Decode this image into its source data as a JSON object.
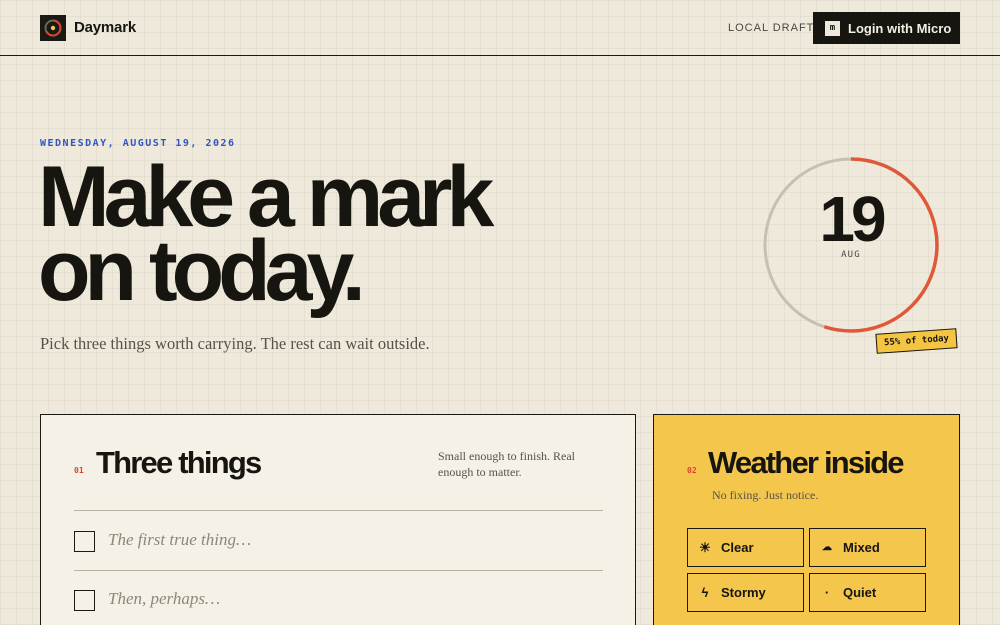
{
  "header": {
    "brand": "Daymark",
    "status": "LOCAL DRAFT",
    "login_label": "Login with Micro",
    "login_icon_glyph": "m"
  },
  "hero": {
    "date": "WEDNESDAY, AUGUST 19, 2026",
    "headline_line1": "Make a mark",
    "headline_line2": "on today.",
    "tagline": "Pick three things worth carrying. The rest can wait outside."
  },
  "dial": {
    "day": "19",
    "month": "AUG",
    "progress_fraction": 0.55,
    "progress_label": "55% of today"
  },
  "things": {
    "number": "01",
    "title": "Three things",
    "subtitle": "Small enough to finish. Real enough to matter.",
    "tasks": [
      {
        "placeholder": "The first true thing…",
        "checked": false
      },
      {
        "placeholder": "Then, perhaps…",
        "checked": false
      }
    ]
  },
  "weather": {
    "number": "02",
    "title": "Weather inside",
    "subtitle": "No fixing. Just notice.",
    "options": [
      {
        "label": "Clear",
        "icon": "sun-icon",
        "glyph": "☀"
      },
      {
        "label": "Mixed",
        "icon": "cloud-icon",
        "glyph": "☁"
      },
      {
        "label": "Stormy",
        "icon": "lightning-icon",
        "glyph": "ϟ"
      },
      {
        "label": "Quiet",
        "icon": "dot-icon",
        "glyph": "·"
      }
    ]
  },
  "colors": {
    "background": "#efe9dc",
    "ink": "#161510",
    "accent_red": "#d9442d",
    "accent_blue": "#2f55c4",
    "accent_yellow": "#f5c64c"
  }
}
